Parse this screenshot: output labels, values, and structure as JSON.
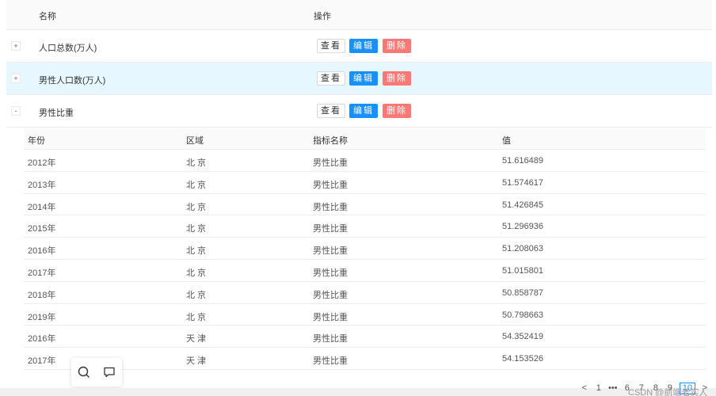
{
  "outer_table": {
    "columns": [
      "名称",
      "操作"
    ],
    "rows": [
      {
        "expander": "+",
        "name": "人口总数(万人)",
        "actions": [
          "查看",
          "编辑",
          "删除"
        ]
      },
      {
        "expander": "+",
        "name": "男性人口数(万人)",
        "actions": [
          "查看",
          "编辑",
          "删除"
        ]
      },
      {
        "expander": "-",
        "name": "男性比重",
        "actions": [
          "查看",
          "编辑",
          "删除"
        ]
      }
    ]
  },
  "inner_table": {
    "columns": [
      "年份",
      "区域",
      "指标名称",
      "值"
    ],
    "rows": [
      [
        "2012年",
        "北 京",
        "男性比重",
        "51.616489"
      ],
      [
        "2013年",
        "北 京",
        "男性比重",
        "51.574617"
      ],
      [
        "2014年",
        "北 京",
        "男性比重",
        "51.426845"
      ],
      [
        "2015年",
        "北 京",
        "男性比重",
        "51.296936"
      ],
      [
        "2016年",
        "北 京",
        "男性比重",
        "51.208063"
      ],
      [
        "2017年",
        "北 京",
        "男性比重",
        "51.015801"
      ],
      [
        "2018年",
        "北 京",
        "男性比重",
        "50.858787"
      ],
      [
        "2019年",
        "北 京",
        "男性比重",
        "50.798663"
      ],
      [
        "2016年",
        "天 津",
        "男性比重",
        "54.352419"
      ],
      [
        "2017年",
        "天 津",
        "男性比重",
        "54.153526"
      ]
    ]
  },
  "pagination": {
    "prev": "<",
    "items": [
      "1",
      "•••",
      "6",
      "7",
      "8",
      "9",
      "10"
    ],
    "active": "10",
    "next": ">"
  },
  "watermark": "CSDN @前端老实人",
  "float_tools": {
    "icons": [
      "search-icon",
      "comment-icon"
    ]
  },
  "colors": {
    "accent": "#1890ff",
    "danger": "#ff7875",
    "highlight_row": "#e6f7ff"
  }
}
